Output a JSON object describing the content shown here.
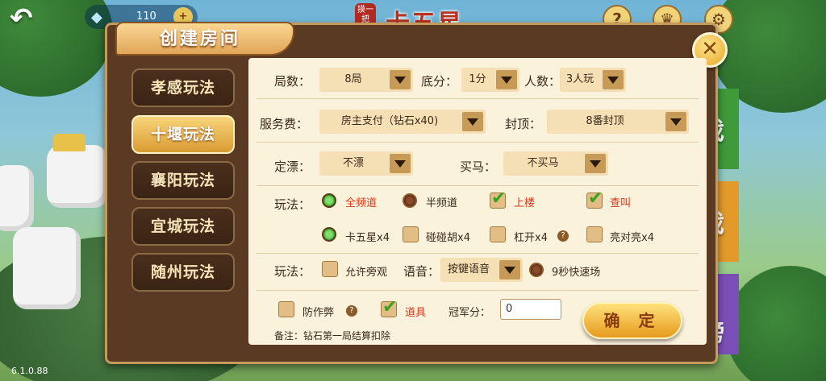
{
  "top_bar": {
    "diamond_count": "110",
    "seal_text": "摸一把",
    "game_title": "卡五星",
    "rules_label": "玩法",
    "record_label": "战绩",
    "back_icon": "back-arrow-icon",
    "settings_icon": "gear-icon"
  },
  "version": "6.1.0.88",
  "dialog": {
    "title": "创建房间",
    "close_icon": "close-icon",
    "modes": [
      "孝感玩法",
      "十堰玩法",
      "襄阳玩法",
      "宜城玩法",
      "随州玩法"
    ],
    "active_mode": "十堰玩法",
    "rounds": {
      "label": "局数：",
      "value": "8局"
    },
    "base_score": {
      "label": "底分：",
      "value": "1分"
    },
    "players": {
      "label": "人数：",
      "value": "3人玩"
    },
    "service_fee": {
      "label": "服务费：",
      "value": "房主支付（钻石x40)"
    },
    "cap": {
      "label": "封顶：",
      "value": "8番封顶"
    },
    "piao": {
      "label": "定漂：",
      "value": "不漂"
    },
    "maima": {
      "label": "买马：",
      "value": "不买马"
    },
    "play_label": "玩法：",
    "play_options_row1": [
      {
        "text": "全频道",
        "kind": "radio",
        "on": true,
        "red": true
      },
      {
        "text": "半频道",
        "kind": "radio",
        "on": false,
        "red": false
      },
      {
        "text": "上楼",
        "kind": "check",
        "on": true,
        "red": true
      },
      {
        "text": "查叫",
        "kind": "check",
        "on": true,
        "red": true
      }
    ],
    "play_options_row2": [
      {
        "text": "卡五星x4",
        "kind": "radio",
        "on": true
      },
      {
        "text": "碰碰胡x4",
        "kind": "check",
        "on": false
      },
      {
        "text": "杠开x4",
        "kind": "check",
        "on": false
      },
      {
        "text": "亮对亮x4",
        "kind": "check",
        "on": false
      }
    ],
    "play2_label": "玩法：",
    "allow_watch": "允许旁观",
    "voice_label": "语音：",
    "voice_value": "按键语音",
    "fast_mode": "9秒快速场",
    "anti_cheat": "防作弊",
    "props": "道具",
    "champion_label": "冠军分：",
    "champion_value": "0",
    "confirm": "确 定",
    "note": "备注：钻石第一局结算扣除"
  },
  "side_tabs": [
    "戏",
    "戏",
    "榜"
  ]
}
